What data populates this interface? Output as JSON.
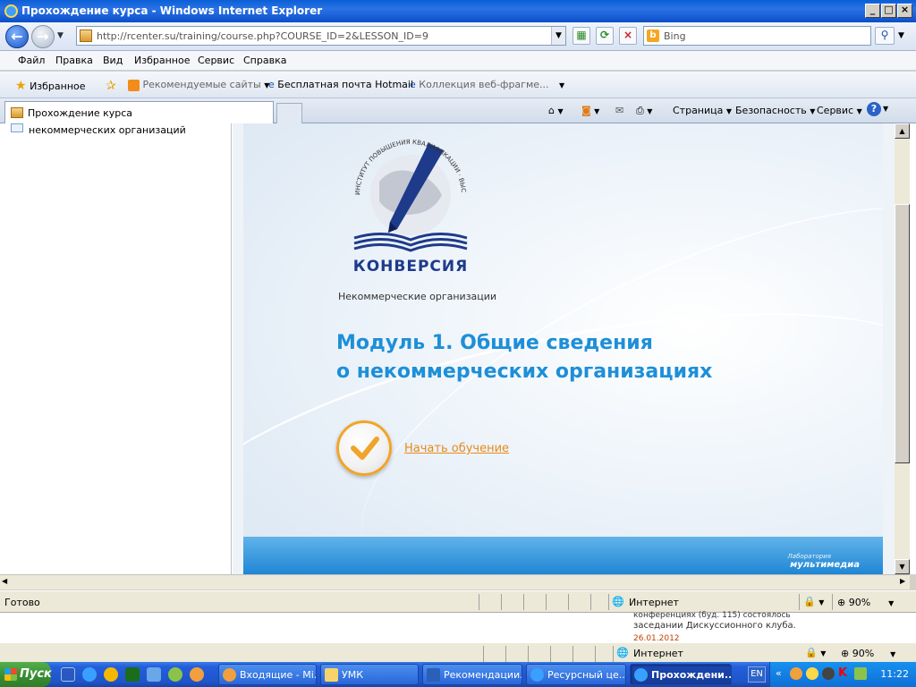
{
  "window": {
    "title": "Прохождение курса - Windows Internet Explorer",
    "min": "_",
    "max": "□",
    "close": "×"
  },
  "nav": {
    "back": "←",
    "forward": "→",
    "url": "http://rcenter.su/training/course.php?COURSE_ID=2&LESSON_ID=9",
    "refresh": "⟳",
    "stop": "×",
    "search_placeholder": "Bing",
    "search_icon": "b"
  },
  "menu": {
    "file": "Файл",
    "edit": "Правка",
    "view": "Вид",
    "favorites": "Избранное",
    "tools": "Сервис",
    "help": "Справка"
  },
  "favbar": {
    "favorites": "Избранное",
    "suggested": "Рекомендуемые сайты",
    "hotmail": "Бесплатная почта Hotmail",
    "gallery": "Коллекция веб-фрагме..."
  },
  "tabs": {
    "active": "Прохождение курса"
  },
  "commands": {
    "page": "Страница",
    "safety": "Безопасность",
    "tools": "Сервис",
    "help": "?"
  },
  "leftpane": {
    "item": "некоммерческих организаций"
  },
  "slide": {
    "logo_ring_text": "ИНСТИТУТ ПОВЫШЕНИЯ КВАЛИФИКАЦИИ · ВЫСШАЯ ШКОЛА БИЗНЕСА",
    "brand": "КОНВЕРСИЯ",
    "subtitle": "Некоммерческие организации",
    "heading_line1": "Модуль 1. Общие сведения",
    "heading_line2": "о некоммерческих организациях",
    "start_link": "Начать обучение",
    "lab_small": "Лаборатория",
    "lab_brand": "мультимедиа"
  },
  "status": {
    "ready": "Готово",
    "zone": "Интернет",
    "zoom": "90%"
  },
  "underlay": {
    "line1": "конференциях (буд. 115) состоялось",
    "line2": "заседании Дискуссионного клуба.",
    "date": "26.01.2012"
  },
  "taskbar": {
    "start": "Пуск",
    "tasks": [
      "Входящие - Mi...",
      "УМК",
      "Рекомендации...",
      "Ресурсный це...",
      "Прохождени..."
    ],
    "lang": "EN",
    "clock": "11:22"
  },
  "colors": {
    "accent": "#1d8fd8",
    "orange": "#f0a52a",
    "titlebar": "#0a5fd6"
  }
}
